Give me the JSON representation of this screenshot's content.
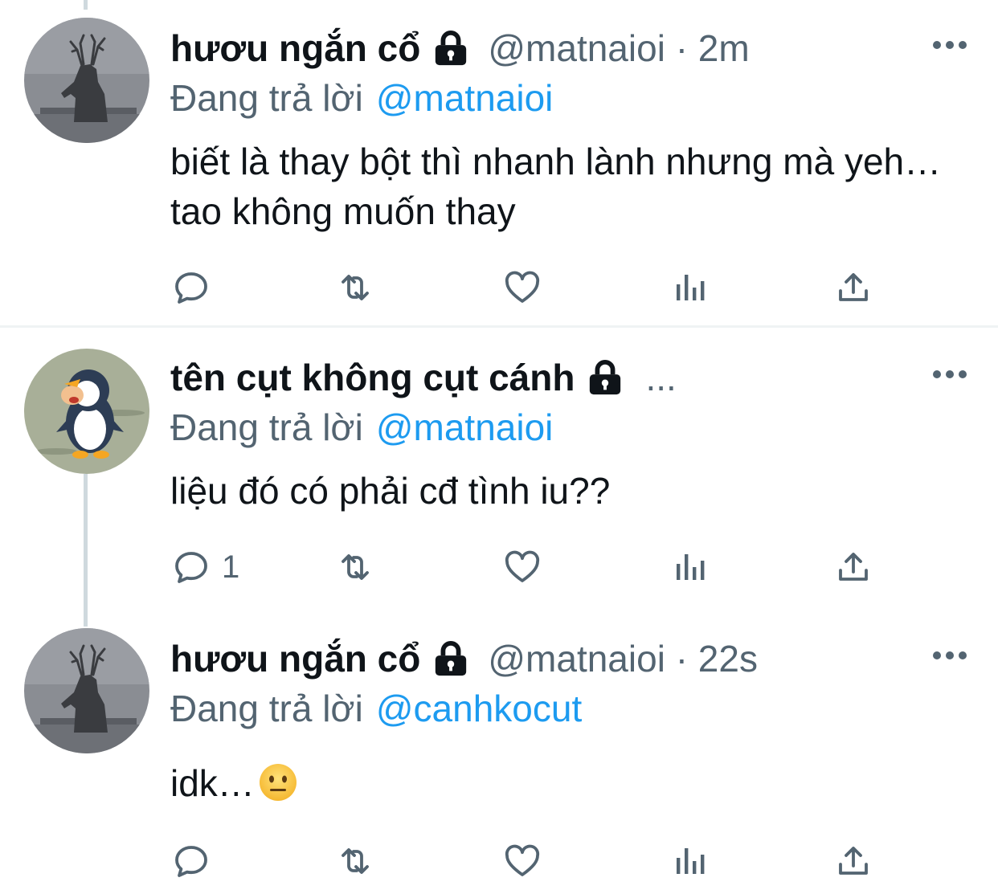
{
  "tweets": [
    {
      "display_name": "hươu ngắn cổ",
      "handle": "@matnaioi · 2m",
      "reply_prefix": "Đang trả lời",
      "reply_mention": "@matnaioi",
      "text": "biết là thay bột thì nhanh lành nhưng mà yeh…tao không muốn thay",
      "reply_count": "",
      "avatar_icon": "deer-avatar",
      "more_icon": "more-horizontal-icon"
    },
    {
      "display_name": "tên cụt không cụt cánh",
      "handle": "...",
      "reply_prefix": "Đang trả lời",
      "reply_mention": "@matnaioi",
      "text": "liệu đó có phải cđ tình iu??",
      "reply_count": "1",
      "avatar_icon": "penguin-avatar",
      "more_icon": "more-horizontal-icon"
    },
    {
      "display_name": "hươu ngắn cổ",
      "handle": "@matnaioi · 22s",
      "reply_prefix": "Đang trả lời",
      "reply_mention": "@canhkocut",
      "text": "idk…",
      "reply_count": "",
      "avatar_icon": "deer-avatar",
      "more_icon": "more-horizontal-icon",
      "emoji": "neutral-face-emoji"
    }
  ],
  "action_icons": [
    "reply-icon",
    "retweet-icon",
    "like-icon",
    "analytics-icon",
    "share-icon"
  ],
  "colors": {
    "text": "#0f1419",
    "secondary": "#536471",
    "link": "#1d9bf0",
    "thread_line": "#cfd9de",
    "divider": "#eff3f4"
  }
}
